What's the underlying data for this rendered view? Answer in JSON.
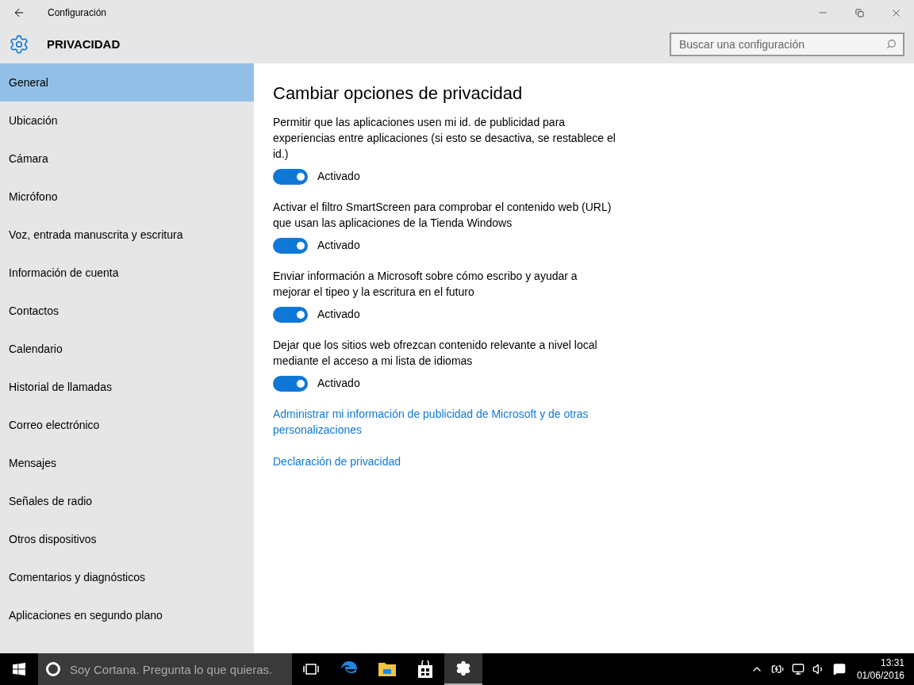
{
  "window": {
    "title": "Configuración"
  },
  "header": {
    "title": "PRIVACIDAD",
    "search": {
      "placeholder": "Buscar una configuración"
    }
  },
  "sidebar": {
    "items": [
      {
        "label": "General",
        "selected": true
      },
      {
        "label": "Ubicación",
        "selected": false
      },
      {
        "label": "Cámara",
        "selected": false
      },
      {
        "label": "Micrófono",
        "selected": false
      },
      {
        "label": "Voz, entrada manuscrita y escritura",
        "selected": false
      },
      {
        "label": "Información de cuenta",
        "selected": false
      },
      {
        "label": "Contactos",
        "selected": false
      },
      {
        "label": "Calendario",
        "selected": false
      },
      {
        "label": "Historial de llamadas",
        "selected": false
      },
      {
        "label": "Correo electrónico",
        "selected": false
      },
      {
        "label": "Mensajes",
        "selected": false
      },
      {
        "label": "Señales de radio",
        "selected": false
      },
      {
        "label": "Otros dispositivos",
        "selected": false
      },
      {
        "label": "Comentarios y diagnósticos",
        "selected": false
      },
      {
        "label": "Aplicaciones en segundo plano",
        "selected": false
      }
    ]
  },
  "content": {
    "heading": "Cambiar opciones de privacidad",
    "settings": [
      {
        "description": "Permitir que las aplicaciones usen mi id. de publicidad para experiencias entre aplicaciones (si esto se desactiva, se restablece el id.)",
        "on": true,
        "state_label": "Activado"
      },
      {
        "description": "Activar el filtro SmartScreen para comprobar el contenido web (URL) que usan las aplicaciones de la Tienda Windows",
        "on": true,
        "state_label": "Activado"
      },
      {
        "description": "Enviar información a Microsoft sobre cómo escribo y ayudar a mejorar el tipeo y la escritura en el futuro",
        "on": true,
        "state_label": "Activado"
      },
      {
        "description": "Dejar que los sitios web ofrezcan contenido relevante a nivel local mediante el acceso a mi lista de idiomas",
        "on": true,
        "state_label": "Activado"
      }
    ],
    "links": [
      "Administrar mi información de publicidad de Microsoft y de otras personalizaciones",
      "Declaración de privacidad"
    ]
  },
  "taskbar": {
    "search_placeholder": "Soy Cortana. Pregunta lo que quieras.",
    "time": "13:31",
    "date": "01/06/2016"
  }
}
